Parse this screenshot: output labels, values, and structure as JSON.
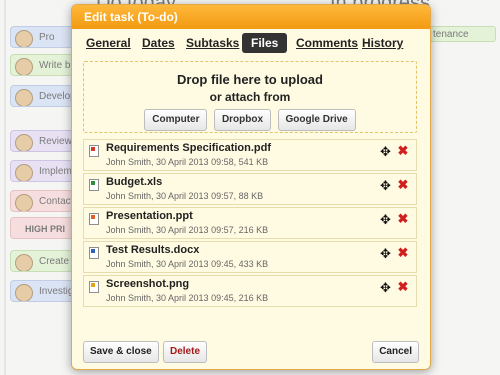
{
  "board": {
    "columns": [
      {
        "title": "Do today"
      },
      {
        "title": "In progress"
      }
    ],
    "cards": [
      {
        "label": "Pro"
      },
      {
        "label": "Write bl"
      },
      {
        "label": "Develop"
      },
      {
        "label": "Review"
      },
      {
        "label": "Impleme"
      },
      {
        "label": "Contact"
      },
      {
        "label": "HIGH PRI"
      },
      {
        "label": "Create a"
      },
      {
        "label": "Investig"
      }
    ],
    "right_card": {
      "label": "tenance"
    }
  },
  "dialog": {
    "title": "Edit task (To-do)",
    "tabs": [
      {
        "label": "General"
      },
      {
        "label": "Dates"
      },
      {
        "label": "Subtasks"
      },
      {
        "label": "Files"
      },
      {
        "label": "Comments"
      },
      {
        "label": "History"
      }
    ],
    "active_tab": "Files",
    "dropzone": {
      "title": "Drop file here to upload",
      "subtitle": "or attach from",
      "sources": [
        {
          "label": "Computer"
        },
        {
          "label": "Dropbox"
        },
        {
          "label": "Google Drive"
        }
      ]
    },
    "files": [
      {
        "name": "Requirements Specification.pdf",
        "meta": "John Smith, 30 April 2013 09:58, 541 KB",
        "icon": "pdf-file-icon"
      },
      {
        "name": "Budget.xls",
        "meta": "John Smith, 30 April 2013 09:57, 88 KB",
        "icon": "spreadsheet-file-icon"
      },
      {
        "name": "Presentation.ppt",
        "meta": "John Smith, 30 April 2013 09:57, 216 KB",
        "icon": "presentation-file-icon"
      },
      {
        "name": "Test Results.docx",
        "meta": "John Smith, 30 April 2013 09:45, 433 KB",
        "icon": "document-file-icon"
      },
      {
        "name": "Screenshot.png",
        "meta": "John Smith, 30 April 2013 09:45, 216 KB",
        "icon": "image-file-icon"
      }
    ],
    "footer": {
      "save_close": "Save & close",
      "delete": "Delete",
      "cancel": "Cancel"
    }
  }
}
